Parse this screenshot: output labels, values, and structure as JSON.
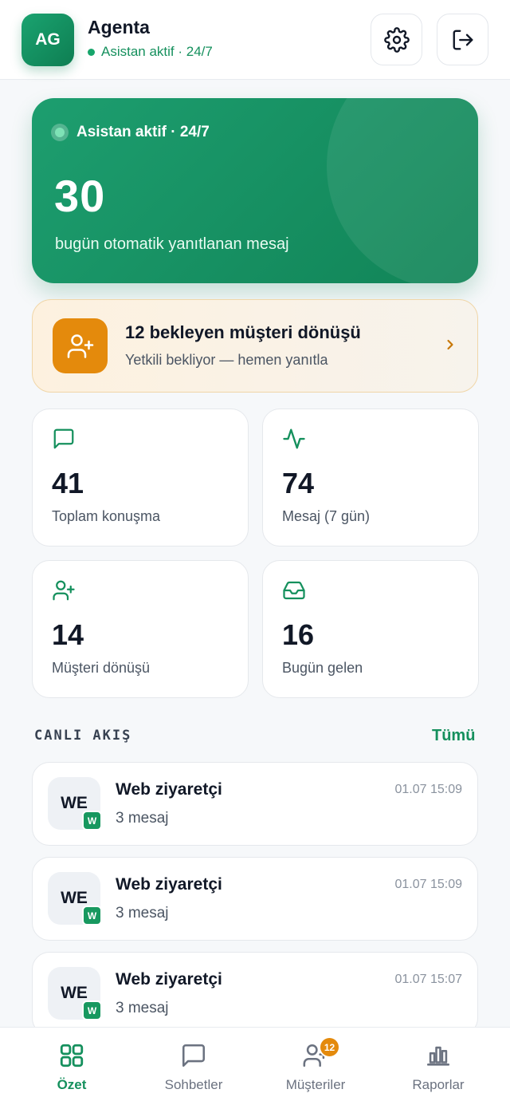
{
  "header": {
    "avatar_initials": "AG",
    "title": "Agenta",
    "status": "Asistan aktif · 24/7",
    "settings_icon": "gear-icon",
    "logout_icon": "logout-icon"
  },
  "hero": {
    "status": "Asistan aktif · 24/7",
    "count": "30",
    "caption": "bugün otomatik yanıtlanan mesaj"
  },
  "pending": {
    "title": "12 bekleyen müşteri dönüşü",
    "subtitle": "Yetkili bekliyor — hemen yanıtla"
  },
  "stats": [
    {
      "value": "41",
      "label": "Toplam konuşma",
      "icon": "chat-icon"
    },
    {
      "value": "74",
      "label": "Mesaj (7 gün)",
      "icon": "activity-icon"
    },
    {
      "value": "14",
      "label": "Müşteri dönüşü",
      "icon": "user-plus-icon"
    },
    {
      "value": "16",
      "label": "Bugün gelen",
      "icon": "inbox-icon"
    }
  ],
  "feed": {
    "title": "CANLI AKIŞ",
    "link": "Tümü",
    "items": [
      {
        "initials": "WE",
        "channel": "W",
        "name": "Web ziyaretçi",
        "subtitle": "3 mesaj",
        "time": "01.07 15:09"
      },
      {
        "initials": "WE",
        "channel": "W",
        "name": "Web ziyaretçi",
        "subtitle": "3 mesaj",
        "time": "01.07 15:09"
      },
      {
        "initials": "WE",
        "channel": "W",
        "name": "Web ziyaretçi",
        "subtitle": "3 mesaj",
        "time": "01.07 15:07"
      }
    ]
  },
  "nav": {
    "items": [
      {
        "label": "Özet",
        "icon": "grid-icon"
      },
      {
        "label": "Sohbetler",
        "icon": "chat-icon"
      },
      {
        "label": "Müşteriler",
        "icon": "users-icon",
        "badge": "12"
      },
      {
        "label": "Raporlar",
        "icon": "bar-chart-icon"
      }
    ]
  },
  "colors": {
    "brand": "#15905d",
    "accent_orange": "#e48a0c",
    "background": "#f6f8fa"
  }
}
